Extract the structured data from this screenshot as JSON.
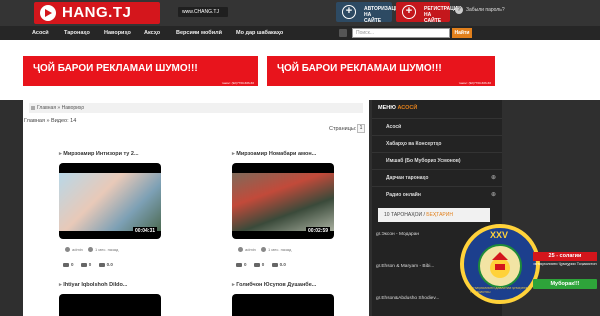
{
  "header": {
    "logo_text": "HANG.TJ",
    "site_url": "www.CHANG.TJ",
    "login_label": "АВТОРИЗАЦИЯ НА САЙТЕ",
    "register_label": "РЕГИСТРАЦИЯ НА САЙТЕ",
    "forgot_label": "Забыли пароль?",
    "forgot_icon": "?"
  },
  "nav": {
    "items": [
      "Асосӣ",
      "Таронаҳо",
      "Навориҳо",
      "Аксҳо",
      "Версияи мобилӣ",
      "Мо дар шабакаҳо"
    ],
    "search_placeholder": "Поиск...",
    "search_button": "Найти"
  },
  "ads": [
    {
      "text": "ҶОЙ БАРОИ РЕКЛАМАИ ШУМО!!!",
      "note": "тамос: (92)7760-666-66"
    },
    {
      "text": "ҶОЙ БАРОИ РЕКЛАМАИ ШУМО!!!",
      "note": "тамос: (92)7760-666-66"
    }
  ],
  "main": {
    "breadcrumb": "Главная » Навориҳо",
    "views": "Главная » Видео: 14",
    "pages_label": "Страницы:",
    "page_number": "1",
    "cards": [
      {
        "title": "Мирзоамир Интизори ту 2...",
        "duration": "00:04:31",
        "author": "admin",
        "date": "1 мес. назад",
        "views": "0",
        "comments": "0",
        "rating": "0.0"
      },
      {
        "title": "Мирзоамир Номабари амон...",
        "duration": "00:02:59",
        "author": "admin",
        "date": "1 мес. назад",
        "views": "0",
        "comments": "0",
        "rating": "0.0"
      },
      {
        "title": "Ihtiyar Iqbolshoh Dildo...",
        "duration": "",
        "author": "",
        "date": "",
        "views": "",
        "comments": "",
        "rating": ""
      },
      {
        "title": "Голибчон Юсупов Душанбе...",
        "duration": "",
        "author": "",
        "date": "",
        "views": "",
        "comments": "",
        "rating": ""
      }
    ]
  },
  "sidebar": {
    "menu_prefix": "МЕНЮ",
    "menu_highlight": "АСОСӢ",
    "items": [
      {
        "label": "Асосӣ",
        "arrow": ""
      },
      {
        "label": "Хабарҳо ва Консертҳо",
        "arrow": ""
      },
      {
        "label": "Имшаб (Бо Мубориз Усмонов)",
        "arrow": ""
      },
      {
        "label": "Дарчаи таронаҳо",
        "arrow": "⊕"
      },
      {
        "label": "Радио онлайн",
        "arrow": "⊕"
      }
    ],
    "tab_prefix": "10 ТАРОНАҲОИ / ",
    "tab_highlight": "БЕҲТАРИН",
    "songs": [
      "gr.Эксон - Модаран",
      "gr.Ehson & Maryam - Bibi...",
      "gr.Ehson&Abdusho Shodiev..."
    ]
  },
  "emblem": {
    "number": "XXV",
    "ring_text": "ИСТИҚЛОЛИЯТИ ДАВЛАТИИ ҶУМҲУРИИ ТОҶИКИСТОН",
    "badge_title": "25 - солагии",
    "badge_sub": "истиқлолияти Ҷумҳурии Тоҷикистон",
    "badge_bottom": "Муборак!!!"
  },
  "colors": {
    "brand_red": "#d4161c",
    "accent_orange": "#e2801c",
    "login_blue": "#2d4a63"
  }
}
